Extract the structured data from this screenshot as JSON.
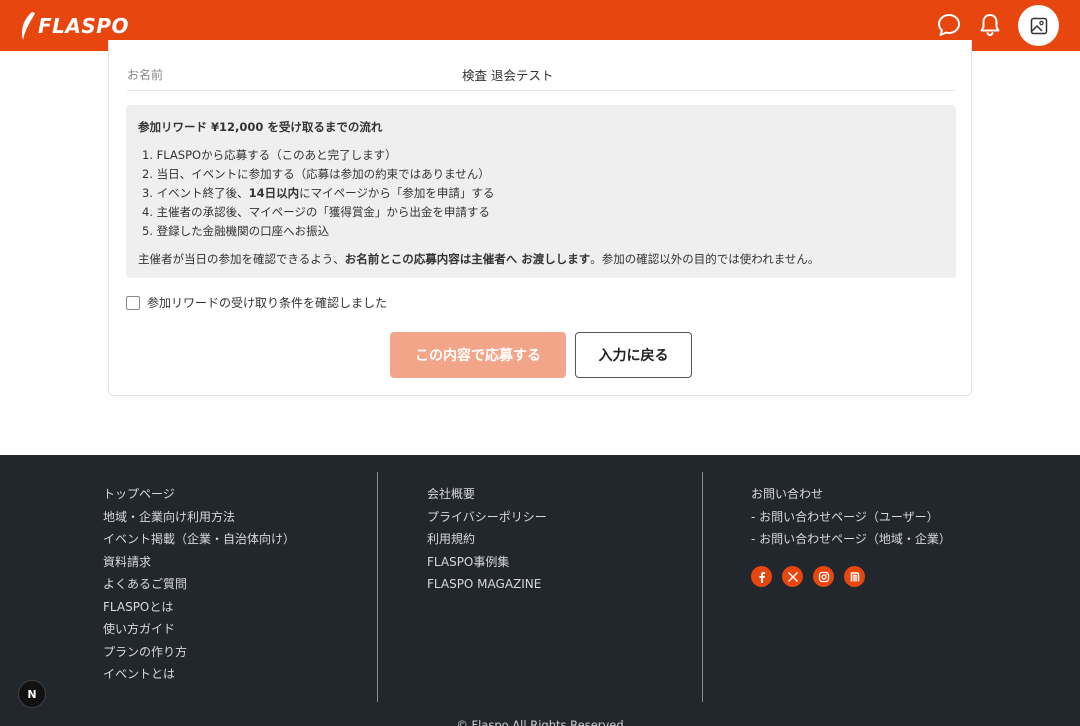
{
  "header": {
    "brand": "FLASPO",
    "icons": [
      "chat-bubble-icon",
      "bell-icon",
      "image-placeholder-icon"
    ],
    "color": "#e8460f"
  },
  "form": {
    "name_label": "お名前",
    "name_value": "検査 退会テスト"
  },
  "info": {
    "title": "参加リワード ¥12,000 を受け取るまでの流れ",
    "steps": [
      {
        "num": "1.",
        "text": "FLASPOから応募する（このあと完了します）"
      },
      {
        "num": "2.",
        "text": "当日、イベントに参加する（応募は参加の約束ではありません）"
      },
      {
        "num": "3.",
        "pre": "イベント終了後、",
        "bold": "14日以内",
        "post": "にマイページから「参加を申請」する"
      },
      {
        "num": "4.",
        "text": "主催者の承認後、マイページの「獲得賞金」から出金を申請する"
      },
      {
        "num": "5.",
        "text": "登録した金融機関の口座へお振込"
      }
    ],
    "note_pre": "主催者が当日の参加を確認できるよう、",
    "note_bold": "お名前とこの応募内容は主催者へ お渡しします",
    "note_post": "。参加の確認以外の目的では使われません。"
  },
  "checkbox_label": "参加リワードの受け取り条件を確認しました",
  "buttons": {
    "apply": "この内容で応募する",
    "back": "入力に戻る"
  },
  "footer": {
    "col1": [
      "トップページ",
      "地域・企業向け利用方法",
      "イベント掲載（企業・自治体向け）",
      "資料請求",
      "よくあるご質問",
      "FLASPOとは",
      "使い方ガイド",
      "プランの作り方",
      "イベントとは"
    ],
    "col2": [
      "会社概要",
      "プライバシーポリシー",
      "利用規約",
      "FLASPO事例集",
      "FLASPO MAGAZINE"
    ],
    "col3": [
      "お問い合わせ",
      "- お問い合わせページ（ユーザー）",
      "- お問い合わせページ（地域・企業）"
    ],
    "social_icons": [
      "facebook-icon",
      "x-icon",
      "instagram-icon",
      "note-icon"
    ],
    "copyright": "© Flaspo All Rights Reserved"
  },
  "badge": "N"
}
